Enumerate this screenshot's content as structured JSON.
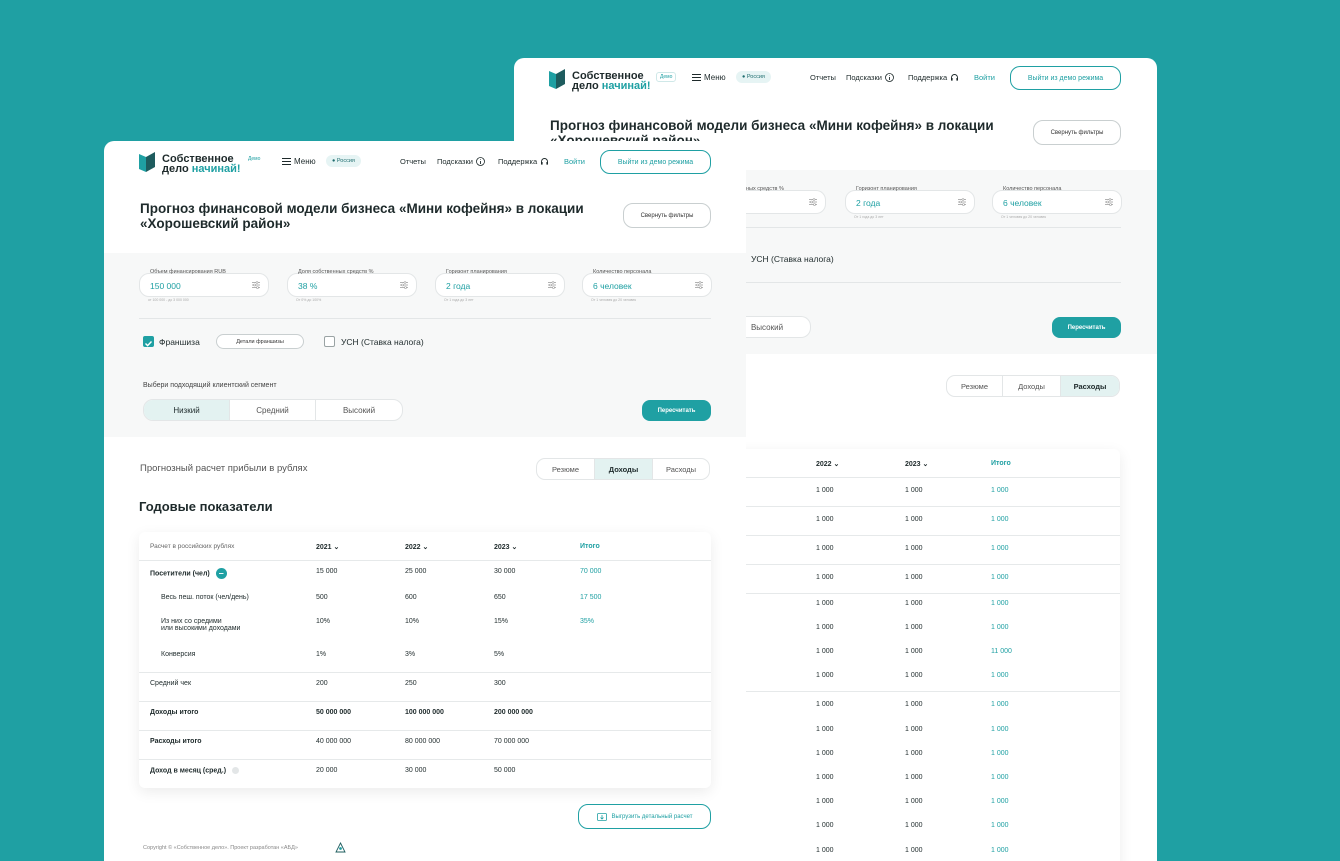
{
  "header": {
    "logo_line1": "Собственное",
    "logo_line2a": "дело",
    "logo_line2b": "начинай!",
    "demo": "Демо",
    "menu": "Меню",
    "region": "Россия",
    "reports": "Отчеты",
    "hints": "Подсказки",
    "support": "Поддержка",
    "login": "Войти",
    "exit_demo": "Выйти из демо режима"
  },
  "page": {
    "title_line1": "Прогноз финансовой модели бизнеса «Мини кофейня» в локации",
    "title_line2": "«Хорошевский район»",
    "collapse_filters": "Свернуть фильтры"
  },
  "filters": {
    "fields": [
      {
        "label": "Объем финансирования RUB",
        "value": "150 000",
        "hint": "от 100 000 - до 3 000 000"
      },
      {
        "label": "Доля собственных средств %",
        "value": "38 %",
        "hint": "От 0% до 100%"
      },
      {
        "label": "Горизонт планирования",
        "value": "2 года",
        "hint": "От 1 года до 3 лет"
      },
      {
        "label": "Количество персонала",
        "value": "6 человек",
        "hint": "От 1 человек до 20 человек"
      }
    ],
    "back_fragment_label": "ных средств %",
    "franchise": "Франшиза",
    "franchise_details": "Детали франшизы",
    "usn": "УСН (Ставка налога)",
    "segment_label": "Выбери подходящий клиентский сегмент",
    "segments": [
      "Низкий",
      "Средний",
      "Высокий"
    ],
    "recalc": "Пересчитать"
  },
  "results": {
    "heading": "Прогнозный расчет прибыли в рублях",
    "tabs": [
      "Резюме",
      "Доходы",
      "Расходы"
    ],
    "annual": "Годовые показатели"
  },
  "table": {
    "caption": "Расчет в российских рублях",
    "years": [
      "2021",
      "2022",
      "2023"
    ],
    "total": "Итого",
    "rows": [
      {
        "label": "Посетители (чел)",
        "v": [
          "15 000",
          "25 000",
          "30 000"
        ],
        "t": "70 000"
      },
      {
        "label": "Весь пеш. поток (чел/день)",
        "v": [
          "500",
          "600",
          "650"
        ],
        "t": "17 500"
      },
      {
        "label": "Из них со средими",
        "label2": "или высокими доходами",
        "v": [
          "10%",
          "10%",
          "15%"
        ],
        "t": "35%"
      },
      {
        "label": "Конверсия",
        "v": [
          "1%",
          "3%",
          "5%"
        ],
        "t": ""
      },
      {
        "label": "Средний чек",
        "v": [
          "200",
          "250",
          "300"
        ],
        "t": ""
      },
      {
        "label": "Доходы итого",
        "v": [
          "50 000 000",
          "100 000 000",
          "200 000 000"
        ],
        "t": ""
      },
      {
        "label": "Расходы итого",
        "v": [
          "40 000 000",
          "80 000 000",
          "70 000 000"
        ],
        "t": ""
      },
      {
        "label": "Доход в месяц (сред.)",
        "v": [
          "20 000",
          "30 000",
          "50 000"
        ],
        "t": ""
      }
    ]
  },
  "back_table": {
    "years": [
      "2022",
      "2023"
    ],
    "total": "Итого",
    "rows": [
      {
        "v": [
          "1 000",
          "1 000"
        ],
        "t": "1 000"
      },
      {
        "v": [
          "1 000",
          "1 000"
        ],
        "t": "1 000"
      },
      {
        "v": [
          "1 000",
          "1 000"
        ],
        "t": "1 000"
      },
      {
        "v": [
          "1 000",
          "1 000"
        ],
        "t": "1 000"
      },
      {
        "v": [
          "1 000",
          "1 000"
        ],
        "t": "1 000"
      },
      {
        "v": [
          "1 000",
          "1 000"
        ],
        "t": "1 000"
      },
      {
        "v": [
          "1 000",
          "1 000"
        ],
        "t": "11 000"
      },
      {
        "v": [
          "1 000",
          "1 000"
        ],
        "t": "1 000"
      },
      {
        "v": [
          "1 000",
          "1 000"
        ],
        "t": "1 000"
      },
      {
        "v": [
          "1 000",
          "1 000"
        ],
        "t": "1 000"
      },
      {
        "v": [
          "1 000",
          "1 000"
        ],
        "t": "1 000"
      },
      {
        "v": [
          "1 000",
          "1 000"
        ],
        "t": "1 000"
      },
      {
        "v": [
          "1 000",
          "1 000"
        ],
        "t": "1 000"
      },
      {
        "v": [
          "1 000",
          "1 000"
        ],
        "t": "1 000"
      },
      {
        "v": [
          "1 000",
          "1 000"
        ],
        "t": "1 000"
      }
    ]
  },
  "footer": {
    "export": "Выгрузить детальный расчет",
    "copyright": "Copyright © «Собственное дело».   Проект разработан «АБД»"
  },
  "colors": {
    "accent": "#1fa0a3",
    "background": "#1fa0a3"
  }
}
